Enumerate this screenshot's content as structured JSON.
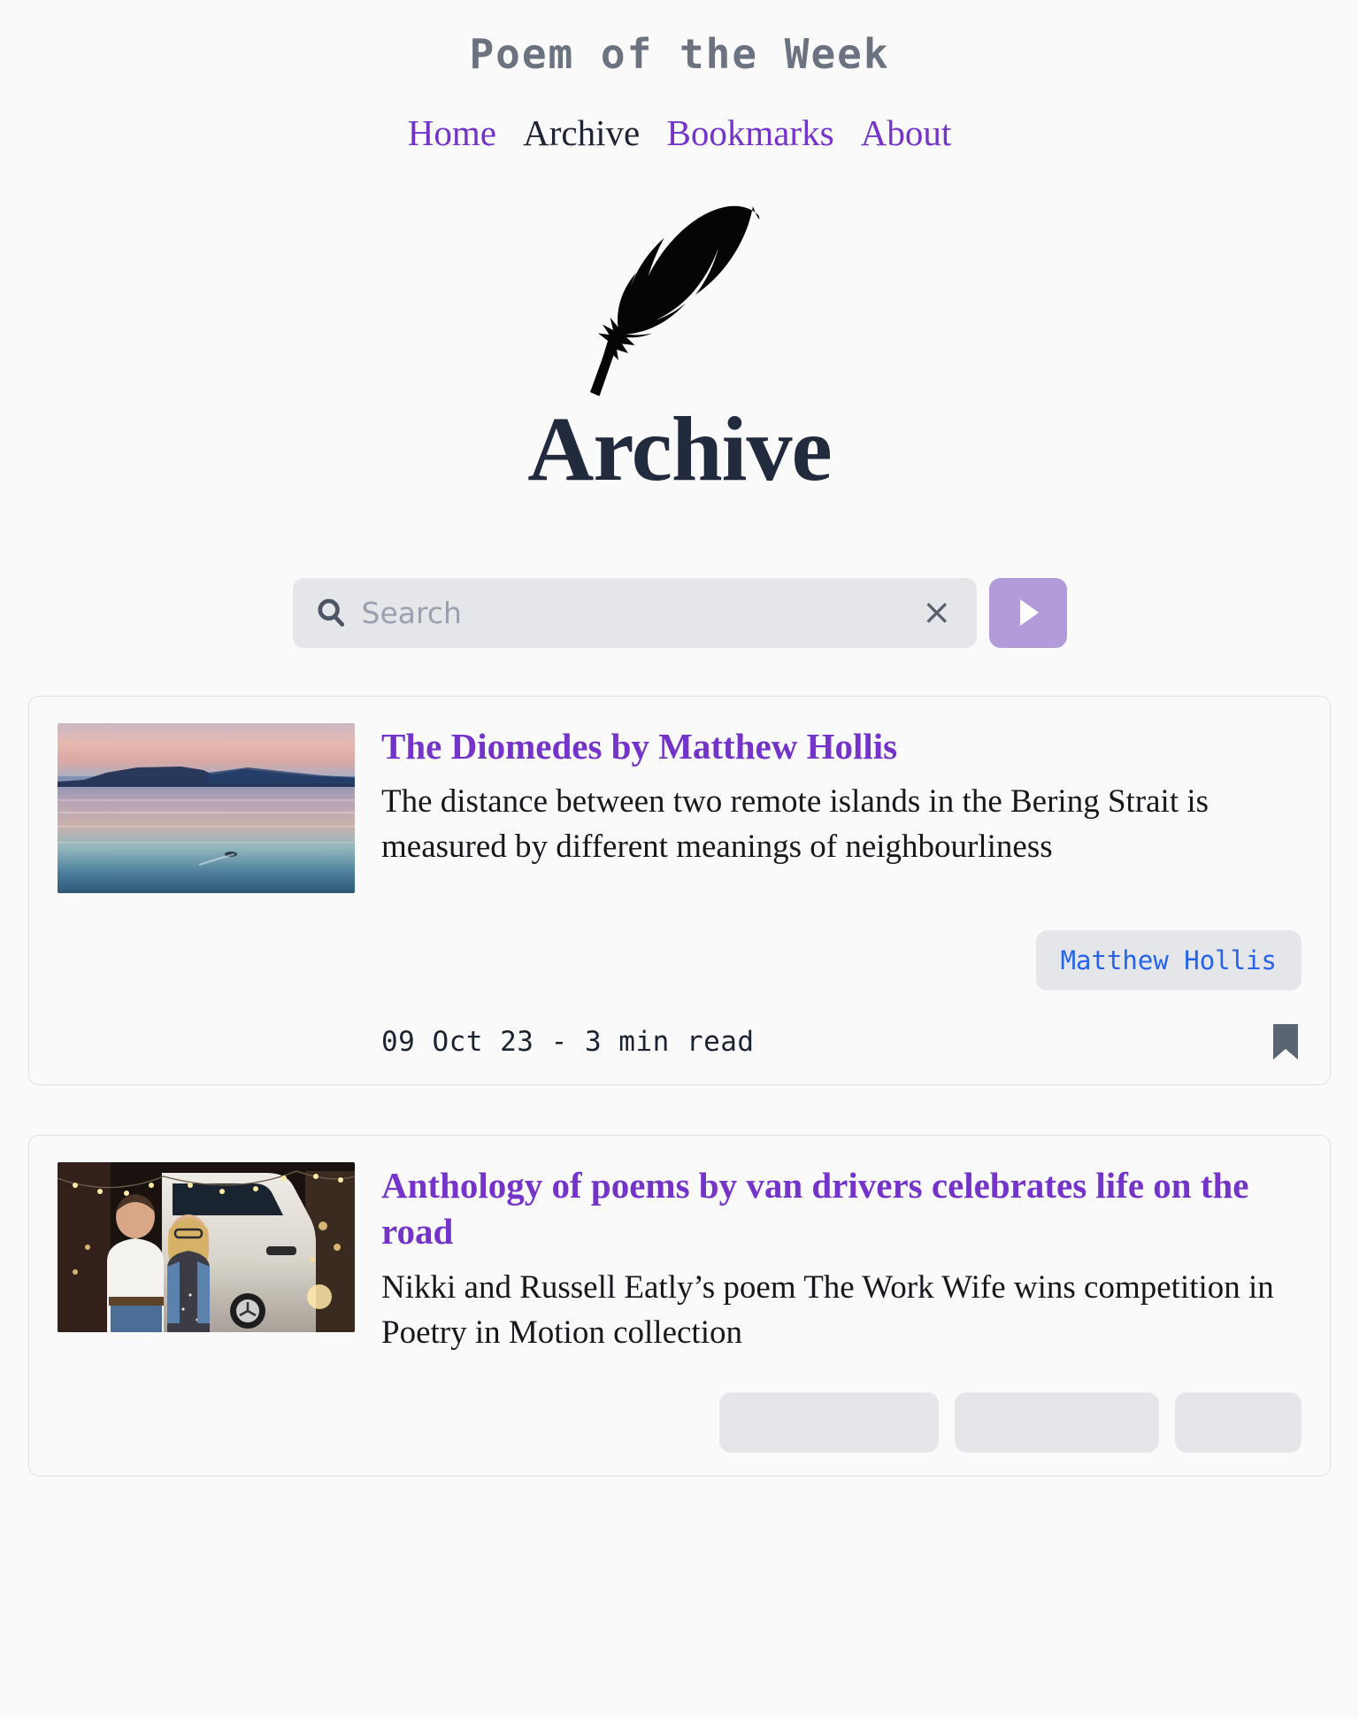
{
  "site": {
    "title": "Poem of the Week"
  },
  "nav": {
    "items": [
      {
        "label": "Home",
        "active": false
      },
      {
        "label": "Archive",
        "active": true
      },
      {
        "label": "Bookmarks",
        "active": false
      },
      {
        "label": "About",
        "active": false
      }
    ]
  },
  "logo": {
    "icon": "feather-icon"
  },
  "heading": {
    "text": "Archive"
  },
  "search": {
    "placeholder": "Search",
    "value": "",
    "search_icon": "search-icon",
    "clear_icon": "×",
    "clear_label": "Clear search",
    "submit_icon": "play-icon",
    "submit_label": "Submit search"
  },
  "colors": {
    "accent_purple": "#7434c9",
    "button_purple": "#b19bd8",
    "tag_blue": "#2563eb",
    "heading_navy": "#222b3d",
    "title_gray": "#6b7280",
    "page_bg": "#fafafa",
    "field_bg": "#e4e6ea",
    "bookmark_gray": "#5b6472"
  },
  "cards": [
    {
      "title": "The Diomedes by Matthew Hollis",
      "description": "The distance between two remote islands in the Bering Strait is measured by different meanings of neighbourliness",
      "thumbnail_alt": "sunset-seascape-island-silhouette",
      "tags": [
        "Matthew Hollis"
      ],
      "date": "09 Oct 23 - 3 min read",
      "bookmark_icon": "bookmark-icon"
    },
    {
      "title": "Anthology of poems by van drivers celebrates life on the road",
      "description": "Nikki and Russell Eatly’s poem The Work Wife wins competition in Poetry in Motion collection",
      "thumbnail_alt": "couple-in-front-of-white-van-at-night",
      "tags": [
        "",
        "",
        ""
      ],
      "date": "",
      "bookmark_icon": "bookmark-icon"
    }
  ]
}
